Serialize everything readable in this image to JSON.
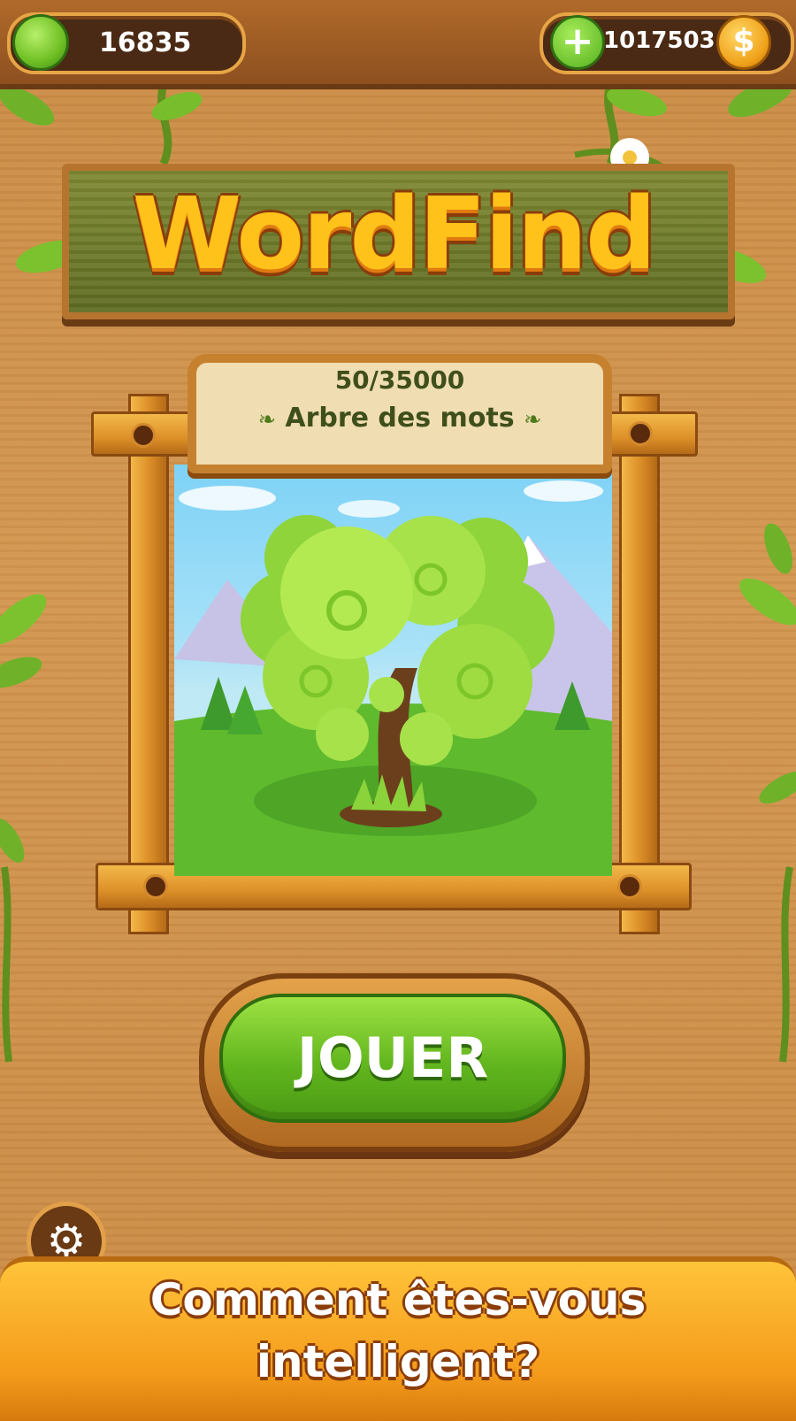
{
  "header": {
    "leaves_count": "16835",
    "coins_count": "1017503",
    "plus_label": "+",
    "coin_symbol": "$"
  },
  "title": {
    "text": "WordFind"
  },
  "tree_card": {
    "progress": "50/35000",
    "name": "Arbre des mots"
  },
  "play_button": {
    "label": "JOUER"
  },
  "banner": {
    "line1": "Comment êtes-vous",
    "line2": "intelligent?"
  },
  "icons": {
    "settings": "gear-icon",
    "leaf": "leaf-icon",
    "coin": "coin-icon"
  },
  "colors": {
    "accent_green": "#62b61e",
    "wood": "#c98a45",
    "title_yellow": "#ffc21a"
  }
}
